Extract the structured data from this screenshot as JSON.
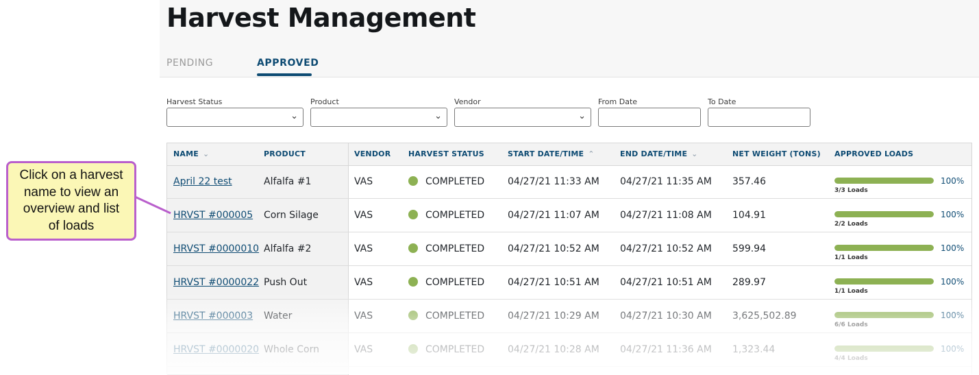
{
  "page": {
    "title": "Harvest Management",
    "tabs": [
      {
        "label": "PENDING",
        "active": false
      },
      {
        "label": "APPROVED",
        "active": true
      }
    ]
  },
  "filters": {
    "harvest_status": {
      "label": "Harvest Status",
      "value": ""
    },
    "product": {
      "label": "Product",
      "value": ""
    },
    "vendor": {
      "label": "Vendor",
      "value": ""
    },
    "from_date": {
      "label": "From Date",
      "value": ""
    },
    "to_date": {
      "label": "To Date",
      "value": ""
    }
  },
  "table": {
    "columns": [
      "NAME",
      "PRODUCT",
      "VENDOR",
      "HARVEST STATUS",
      "START DATE/TIME",
      "END DATE/TIME",
      "NET WEIGHT (TONS)",
      "APPROVED LOADS"
    ],
    "rows": [
      {
        "name": "April 22 test",
        "product": "Alfalfa #1",
        "vendor": "VAS",
        "status": "COMPLETED",
        "start": "04/27/21 11:33 AM",
        "end": "04/27/21 11:35 AM",
        "weight": "357.46",
        "progress": 1.0,
        "pct": "100%",
        "loads": "3/3 Loads"
      },
      {
        "name": "HRVST #000005",
        "product": "Corn Silage",
        "vendor": "VAS",
        "status": "COMPLETED",
        "start": "04/27/21 11:07 AM",
        "end": "04/27/21 11:08 AM",
        "weight": "104.91",
        "progress": 1.0,
        "pct": "100%",
        "loads": "2/2 Loads"
      },
      {
        "name": "HRVST #0000010",
        "product": "Alfalfa #2",
        "vendor": "VAS",
        "status": "COMPLETED",
        "start": "04/27/21 10:52 AM",
        "end": "04/27/21 10:52 AM",
        "weight": "599.94",
        "progress": 1.0,
        "pct": "100%",
        "loads": "1/1 Loads"
      },
      {
        "name": "HRVST #0000022",
        "product": "Push Out",
        "vendor": "VAS",
        "status": "COMPLETED",
        "start": "04/27/21 10:51 AM",
        "end": "04/27/21 10:51 AM",
        "weight": "289.97",
        "progress": 1.0,
        "pct": "100%",
        "loads": "1/1 Loads"
      },
      {
        "name": "HRVST #000003",
        "product": "Water",
        "vendor": "VAS",
        "status": "COMPLETED",
        "start": "04/27/21 10:29 AM",
        "end": "04/27/21 10:30 AM",
        "weight": "3,625,502.89",
        "progress": 1.0,
        "pct": "100%",
        "loads": "6/6 Loads"
      },
      {
        "name": "HRVST #0000020",
        "product": "Whole Corn",
        "vendor": "VAS",
        "status": "COMPLETED",
        "start": "04/27/21 10:28 AM",
        "end": "04/27/21 11:36 AM",
        "weight": "1,323.44",
        "progress": 1.0,
        "pct": "100%",
        "loads": "4/4 Loads"
      }
    ]
  },
  "callout": {
    "text": "Click on a harvest\nname to view an\noverview and list\nof loads"
  },
  "colors": {
    "accent": "#0e4b73",
    "status_completed": "#8db153",
    "callout_border": "#b95fcc",
    "callout_fill": "#fbf7b6"
  }
}
